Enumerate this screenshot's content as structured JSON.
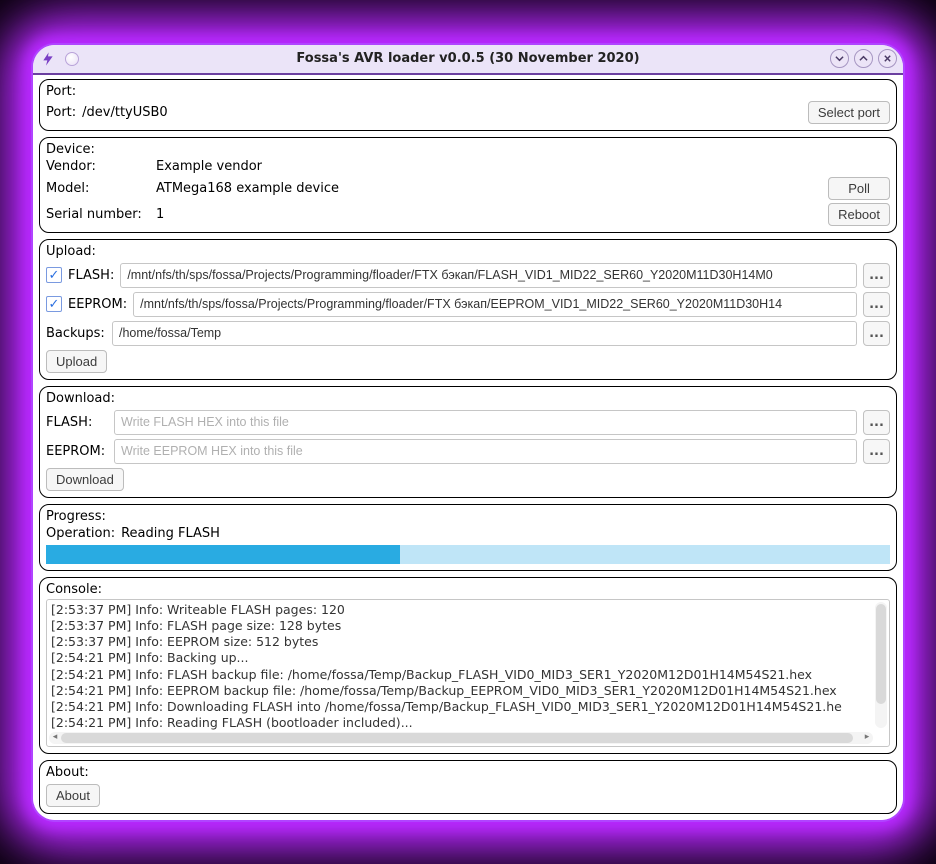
{
  "window": {
    "title": "Fossa's AVR loader v0.0.5 (30 November 2020)"
  },
  "port": {
    "section_label": "Port:",
    "port_label": "Port:",
    "port_value": "/dev/ttyUSB0",
    "select_btn": "Select port"
  },
  "device": {
    "section_label": "Device:",
    "vendor_label": "Vendor:",
    "vendor_value": "Example vendor",
    "model_label": "Model:",
    "model_value": "ATMega168 example device",
    "serial_label": "Serial number:",
    "serial_value": "1",
    "poll_btn": "Poll",
    "reboot_btn": "Reboot"
  },
  "upload": {
    "section_label": "Upload:",
    "flash_label": "FLASH:",
    "flash_path": "/mnt/nfs/th/sps/fossa/Projects/Programming/floader/FTX бэкап/FLASH_VID1_MID22_SER60_Y2020M11D30H14M0",
    "eeprom_label": "EEPROM:",
    "eeprom_path": "/mnt/nfs/th/sps/fossa/Projects/Programming/floader/FTX бэкап/EEPROM_VID1_MID22_SER60_Y2020M11D30H14",
    "backups_label": "Backups:",
    "backups_path": "/home/fossa/Temp",
    "upload_btn": "Upload",
    "browse": "..."
  },
  "download": {
    "section_label": "Download:",
    "flash_label": "FLASH:",
    "flash_placeholder": "Write FLASH HEX into this file",
    "eeprom_label": "EEPROM:",
    "eeprom_placeholder": "Write EEPROM HEX into this file",
    "download_btn": "Download",
    "browse": "..."
  },
  "progress": {
    "section_label": "Progress:",
    "operation_label": "Operation:",
    "operation_value": "Reading FLASH",
    "percent": 42
  },
  "console": {
    "section_label": "Console:",
    "lines": [
      "[2:53:37 PM] Info: Writeable FLASH pages: 120",
      "[2:53:37 PM] Info: FLASH page size: 128 bytes",
      "[2:53:37 PM] Info: EEPROM size: 512 bytes",
      "[2:54:21 PM] Info: Backing up...",
      "[2:54:21 PM] Info: FLASH backup file: /home/fossa/Temp/Backup_FLASH_VID0_MID3_SER1_Y2020M12D01H14M54S21.hex",
      "[2:54:21 PM] Info: EEPROM backup file: /home/fossa/Temp/Backup_EEPROM_VID0_MID3_SER1_Y2020M12D01H14M54S21.hex",
      "[2:54:21 PM] Info: Downloading FLASH into /home/fossa/Temp/Backup_FLASH_VID0_MID3_SER1_Y2020M12D01H14M54S21.he",
      "[2:54:21 PM] Info: Reading FLASH (bootloader included)..."
    ]
  },
  "about": {
    "section_label": "About:",
    "about_btn": "About"
  }
}
